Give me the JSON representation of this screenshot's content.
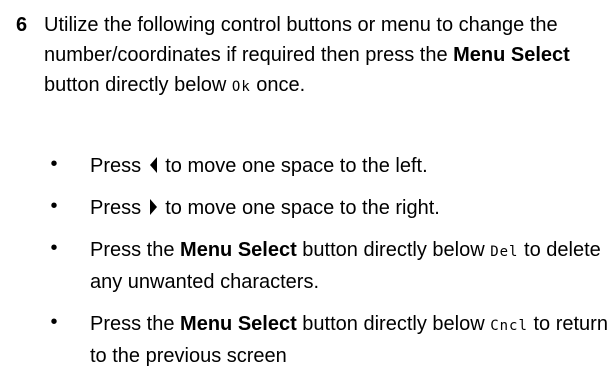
{
  "step": {
    "number": "6",
    "intro": {
      "t1": "Utilize the following control buttons or menu to change the number/coordinates if required then press the ",
      "b1": "Menu Select",
      "t2": " button directly below ",
      "lcd1": "Ok",
      "t3": " once."
    }
  },
  "bullets": [
    {
      "pre": "Press ",
      "icon": "left-arrow-icon",
      "post": " to move one space to the left."
    },
    {
      "pre": "Press ",
      "icon": "right-arrow-icon",
      "post": " to move one space to the right."
    },
    {
      "pre": "Press the ",
      "bold": "Menu Select",
      "mid": " button directly below ",
      "lcd": "Del",
      "post": " to delete any unwanted characters."
    },
    {
      "pre": "Press the ",
      "bold": "Menu Select",
      "mid": " button directly below ",
      "lcd": "Cncl",
      "post": " to return to the previous screen"
    }
  ],
  "bullet_char": "•"
}
